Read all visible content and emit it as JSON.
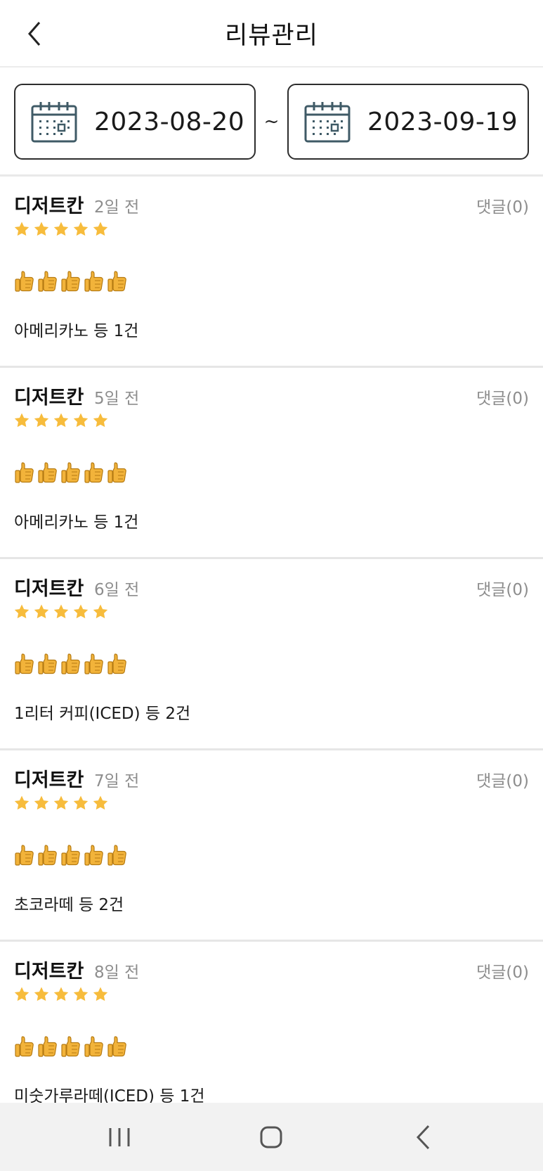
{
  "header": {
    "title": "리뷰관리",
    "back_icon": "chevron-left-icon"
  },
  "date_range": {
    "start": "2023-08-20",
    "end": "2023-09-19",
    "separator": "~",
    "icon": "calendar-icon"
  },
  "reviews": [
    {
      "store": "디저트칸",
      "ago": "2일 전",
      "reply": "댓글(0)",
      "rating": 5,
      "thumbs": 5,
      "items": "아메리카노 등 1건"
    },
    {
      "store": "디저트칸",
      "ago": "5일 전",
      "reply": "댓글(0)",
      "rating": 5,
      "thumbs": 5,
      "items": "아메리카노 등 1건"
    },
    {
      "store": "디저트칸",
      "ago": "6일 전",
      "reply": "댓글(0)",
      "rating": 5,
      "thumbs": 5,
      "items": "1리터 커피(ICED) 등 2건"
    },
    {
      "store": "디저트칸",
      "ago": "7일 전",
      "reply": "댓글(0)",
      "rating": 5,
      "thumbs": 5,
      "items": "초코라떼 등 2건"
    },
    {
      "store": "디저트칸",
      "ago": "8일 전",
      "reply": "댓글(0)",
      "rating": 5,
      "thumbs": 5,
      "items": "미숫가루라떼(ICED) 등 1건"
    }
  ],
  "colors": {
    "star": "#F7BC3C",
    "meta_text": "#8D8D8D",
    "border": "#2D2D2D",
    "calendar": "#3F5A66",
    "navbar": "#F2F2F2"
  },
  "system_nav": {
    "recent_icon": "recent-apps-icon",
    "home_icon": "home-icon",
    "back_icon": "back-icon"
  }
}
